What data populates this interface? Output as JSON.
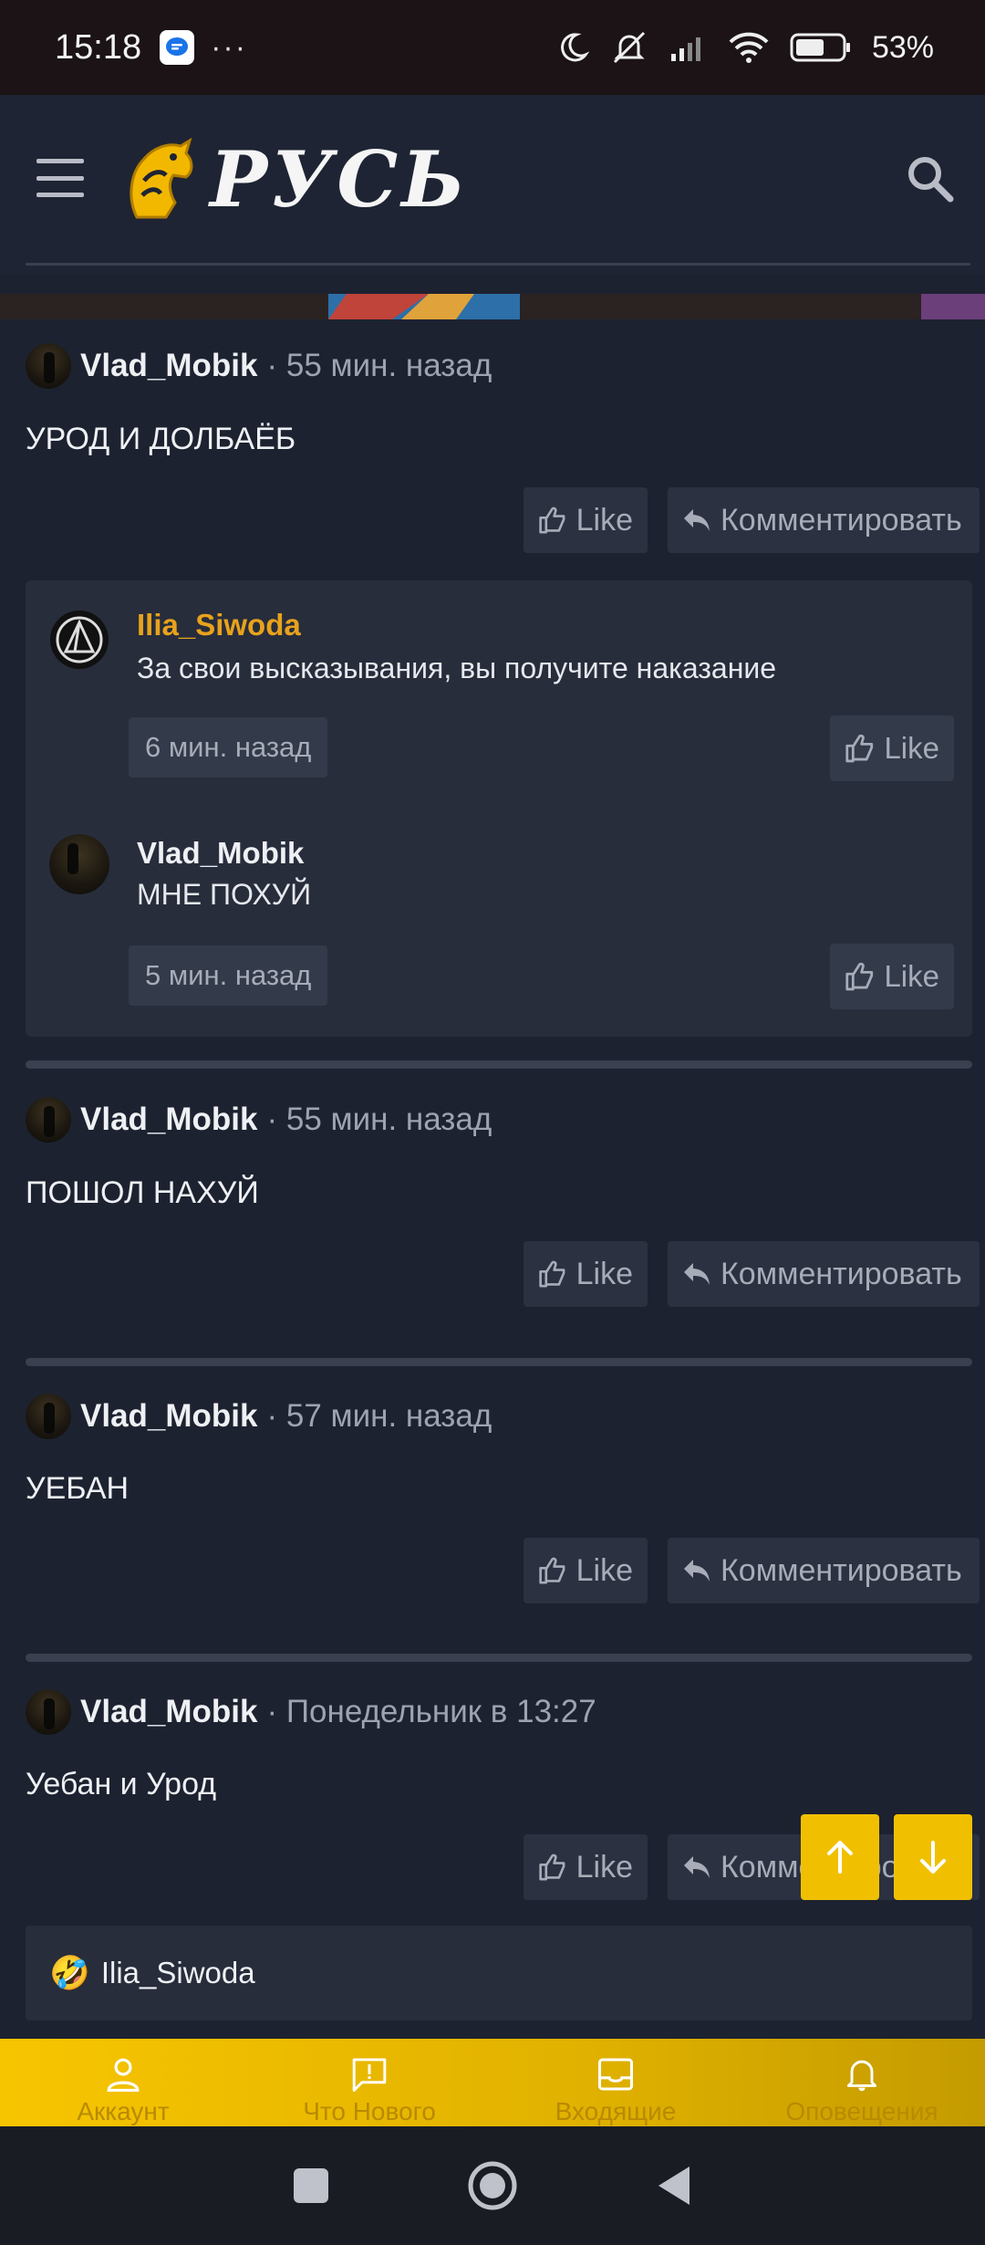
{
  "status_bar": {
    "time": "15:18",
    "more": "···",
    "battery_percent": "53%",
    "icons": [
      "messages-app-icon",
      "moon-icon",
      "silent-bell-icon",
      "signal-icon",
      "wifi-icon",
      "battery-icon"
    ]
  },
  "header": {
    "logo_text": "РУСЬ",
    "menu_icon": "hamburger-icon",
    "search_icon": "search-icon"
  },
  "posts": [
    {
      "author": "Vlad_Mobik",
      "meta": "· 55 мин. назад",
      "text": "УРОД И ДОЛБАЁБ",
      "like_label": "Like",
      "comment_label": "Комментировать"
    },
    {
      "author": "Vlad_Mobik",
      "meta": "· 55 мин. назад",
      "text": "ПОШОЛ НАХУЙ",
      "like_label": "Like",
      "comment_label": "Комментировать"
    },
    {
      "author": "Vlad_Mobik",
      "meta": "· 57 мин. назад",
      "text": "УЕБАН",
      "like_label": "Like",
      "comment_label": "Комментировать"
    },
    {
      "author": "Vlad_Mobik",
      "meta": "· Понедельник в 13:27",
      "text": "Уебан и Урод",
      "like_label": "Like",
      "comment_label": "Комментировать"
    }
  ],
  "comments": [
    {
      "author": "Ilia_Siwoda",
      "text": "За свои высказывания, вы получите наказание",
      "time": "6 мин. назад",
      "like_label": "Like",
      "name_color": "#e8a21c"
    },
    {
      "author": "Vlad_Mobik",
      "text": "МНЕ ПОХУЙ",
      "time": "5 мин. назад",
      "like_label": "Like",
      "name_color": "#eef0f4"
    }
  ],
  "reactions": {
    "user": "Ilia_Siwoda",
    "emoji": "🤣"
  },
  "bottom_nav": [
    {
      "label": "Аккаунт",
      "icon": "account-icon"
    },
    {
      "label": "Что Нового",
      "icon": "whats-new-icon"
    },
    {
      "label": "Входящие",
      "icon": "inbox-icon"
    },
    {
      "label": "Оповещения",
      "icon": "bell-icon"
    }
  ],
  "colors": {
    "accent": "#f0c000",
    "background": "#1d2230",
    "moderator_name": "#e8a21c"
  }
}
